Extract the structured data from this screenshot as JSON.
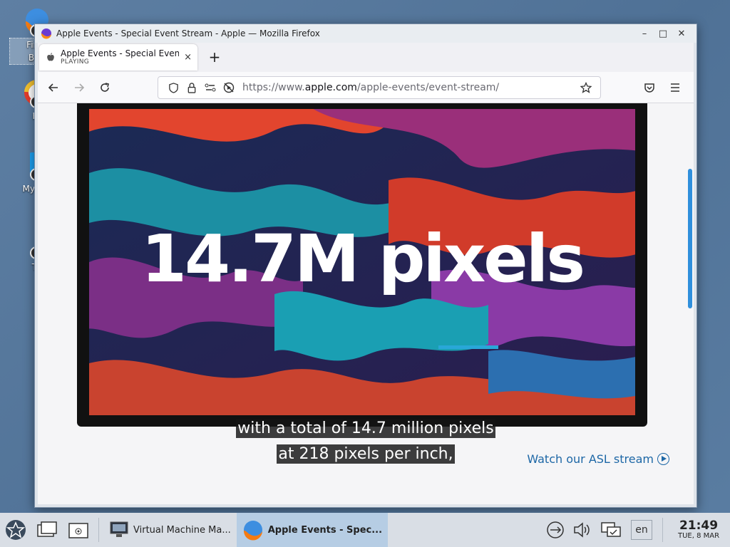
{
  "desktop": {
    "icons": [
      {
        "label": "Firefox Bro",
        "line1": "Firef",
        "line2": "Bro"
      },
      {
        "label": "H"
      },
      {
        "label": "My Co"
      },
      {
        "label": "Tr"
      }
    ]
  },
  "window": {
    "title": "Apple Events - Special Event Stream - Apple — Mozilla Firefox",
    "controls": {
      "minimize": "–",
      "maximize": "□",
      "close": "✕"
    }
  },
  "tab": {
    "title": "Apple Events - Special Event Stream - Apple",
    "status": "PLAYING",
    "close": "×",
    "new_tab": "+"
  },
  "navbar": {
    "url_prefix": "https://www.",
    "url_domain": "apple.com",
    "url_path": "/apple-events/event-stream/"
  },
  "content": {
    "headline": "14.7M pixels",
    "caption_line1": "with a total of 14.7 million pixels",
    "caption_line2": "at 218 pixels per inch,",
    "asl_link": "Watch our ASL stream"
  },
  "taskbar": {
    "tasks": [
      {
        "label": "Virtual Machine Ma..."
      },
      {
        "label": "Apple Events - Spec..."
      }
    ],
    "lang": "en",
    "time": "21:49",
    "date": "TUE, 8 MAR"
  },
  "colors": {
    "accent": "#2f8fdc",
    "link": "#1d67a6",
    "active_task": "#b6cde4"
  }
}
